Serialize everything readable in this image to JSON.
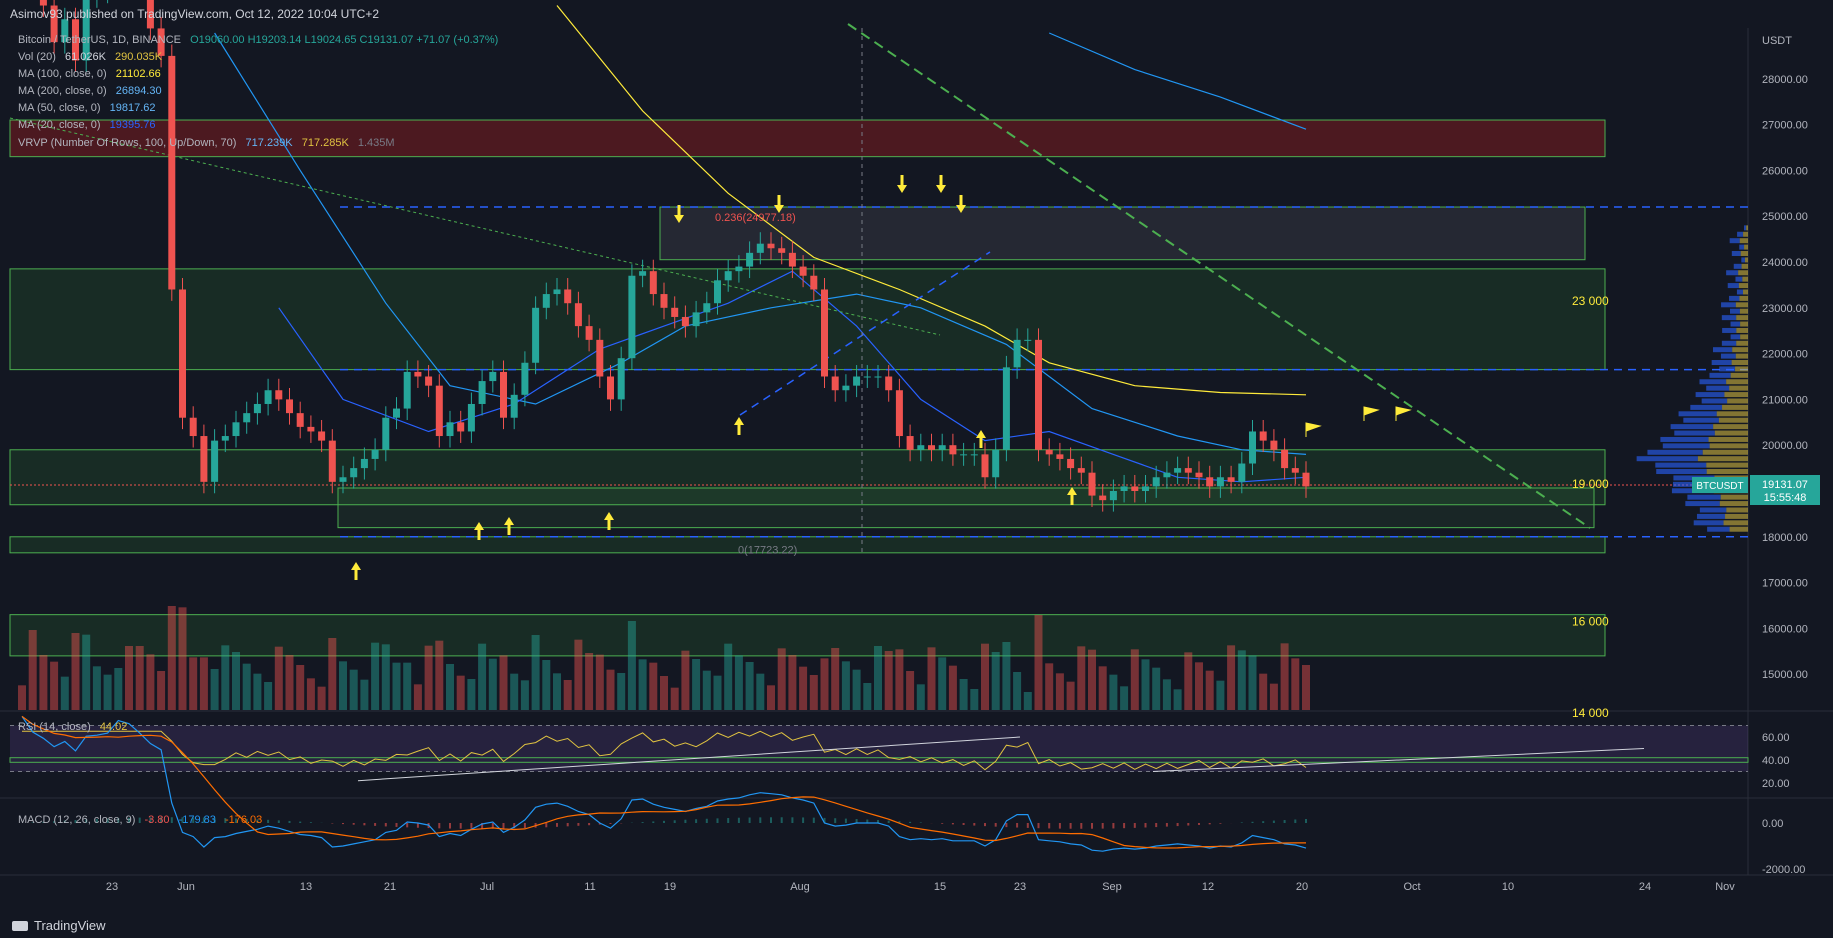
{
  "header": {
    "publisher_text": "Asimov93 published on TradingView.com, Oct 12, 2022 10:04 UTC+2"
  },
  "legend": {
    "symbol": "Bitcoin / TetherUS, 1D, BINANCE",
    "ohlc": "O19060.00 H19203.14 L19024.65 C19131.07 +71.07 (+0.37%)",
    "vol": {
      "label": "Vol (20)",
      "v1": "61.026K",
      "v2": "290.035K"
    },
    "ma100": {
      "label": "MA (100, close, 0)",
      "value": "21102.66"
    },
    "ma200": {
      "label": "MA (200, close, 0)",
      "value": "26894.30"
    },
    "ma50": {
      "label": "MA (50, close, 0)",
      "value": "19817.62"
    },
    "ma20": {
      "label": "MA (20, close, 0)",
      "value": "19395.76"
    },
    "vrvp": {
      "label": "VRVP (Number Of Rows, 100, Up/Down, 70)",
      "v1": "717.239K",
      "v2": "717.285K",
      "v3": "1.435M"
    },
    "rsi": {
      "label": "RSI (14, close)",
      "value": "44.02"
    },
    "macd": {
      "label": "MACD (12, 26, close, 9)",
      "v1": "-3.80",
      "v2": "-179.83",
      "v3": "-176.03"
    }
  },
  "footer": {
    "logo_text": "TradingView"
  },
  "colors": {
    "background": "#131722",
    "up": "#26a69a",
    "down": "#ef5350",
    "zone_green": "#1b5e20",
    "zone_red": "#7a1f2b",
    "ma20": "#2962ff",
    "ma50": "#2196f3",
    "ma100": "#ffeb3b",
    "rsi_line": "#e0c341",
    "macd": "#2196f3",
    "signal": "#ff6d00",
    "price_tag": "#26a69a"
  },
  "chart_data": [
    {
      "type": "candlestick",
      "title": "Bitcoin / TetherUS, 1D, BINANCE",
      "x_ticks": [
        "23",
        "Jun",
        "13",
        "21",
        "Jul",
        "11",
        "19",
        "Aug",
        "15",
        "23",
        "Sep",
        "12",
        "20",
        "Oct",
        "10",
        "24",
        "Nov"
      ],
      "y_ticks": [
        28000,
        27000,
        26000,
        25000,
        24000,
        23000,
        22000,
        21000,
        20000,
        19000,
        18000,
        17000,
        16000,
        15000
      ],
      "ylim": [
        14000,
        29000
      ],
      "y_unit": "USDT",
      "candles_close": [
        31700,
        30200,
        29600,
        28800,
        29300,
        28400,
        29800,
        29900,
        30100,
        31300,
        31000,
        30100,
        29100,
        28500,
        23400,
        20600,
        20200,
        19200,
        20100,
        20200,
        20500,
        20700,
        20900,
        21200,
        21000,
        20700,
        20400,
        20300,
        20100,
        19200,
        19300,
        19500,
        19700,
        19900,
        20600,
        20800,
        21600,
        21500,
        21300,
        20200,
        20500,
        20300,
        20900,
        21400,
        21600,
        20600,
        21100,
        21800,
        23000,
        23300,
        23400,
        23100,
        22600,
        22300,
        21500,
        21000,
        21900,
        23700,
        23800,
        23300,
        23000,
        22800,
        22600,
        22900,
        23100,
        23600,
        23800,
        23900,
        24200,
        24400,
        24300,
        24200,
        23900,
        23700,
        23400,
        21500,
        21200,
        21300,
        21500,
        21500,
        21500,
        21200,
        20200,
        19900,
        20000,
        19900,
        20000,
        19800,
        19800,
        19800,
        19300,
        19900,
        21700,
        22300,
        22300,
        19900,
        19800,
        19700,
        19500,
        19400,
        18900,
        18800,
        19000,
        19100,
        19000,
        19100,
        19300,
        19400,
        19500,
        19400,
        19300,
        19100,
        19300,
        19200,
        19600,
        20300,
        20100,
        19900,
        19500,
        19400,
        19100
      ],
      "price_last": 19131.07,
      "last_label": "BTCUSDT",
      "countdown": "15:55:48",
      "levels": [
        {
          "label": "23 000",
          "y": 23000
        },
        {
          "label": "19 000",
          "y": 19000
        },
        {
          "label": "16 000",
          "y": 16000
        },
        {
          "label": "14 000",
          "y": 14000
        }
      ],
      "zones": [
        {
          "kind": "resistance",
          "y_from": 26300,
          "y_to": 27100
        },
        {
          "kind": "support",
          "y_from": 21650,
          "y_to": 23850
        },
        {
          "kind": "support",
          "y_from": 18700,
          "y_to": 19900
        },
        {
          "kind": "support",
          "y_from": 17650,
          "y_to": 18000
        },
        {
          "kind": "support",
          "y_from": 15400,
          "y_to": 16300
        },
        {
          "kind": "range",
          "y_from": 24050,
          "y_to": 25200
        }
      ],
      "dashed_levels": [
        25200,
        21650,
        18000
      ],
      "fib_labels": [
        {
          "text": "0.236(24977.18)",
          "y": 24977.18
        },
        {
          "text": "0(17723.22)",
          "y": 17723.22
        }
      ]
    },
    {
      "type": "line",
      "title": "RSI (14, close)",
      "y_ticks": [
        60,
        40,
        20
      ],
      "ylim": [
        15,
        70
      ],
      "bands": [
        30,
        70
      ],
      "last_value": 44.02
    },
    {
      "type": "line",
      "title": "MACD (12, 26, close, 9)",
      "y_ticks": [
        0,
        -2000
      ],
      "y_tick_labels": [
        "0.00",
        "-2000.00"
      ],
      "ylim": [
        -2600,
        600
      ],
      "values": {
        "histogram": -3.8,
        "macd": -179.83,
        "signal": -176.03
      }
    }
  ]
}
